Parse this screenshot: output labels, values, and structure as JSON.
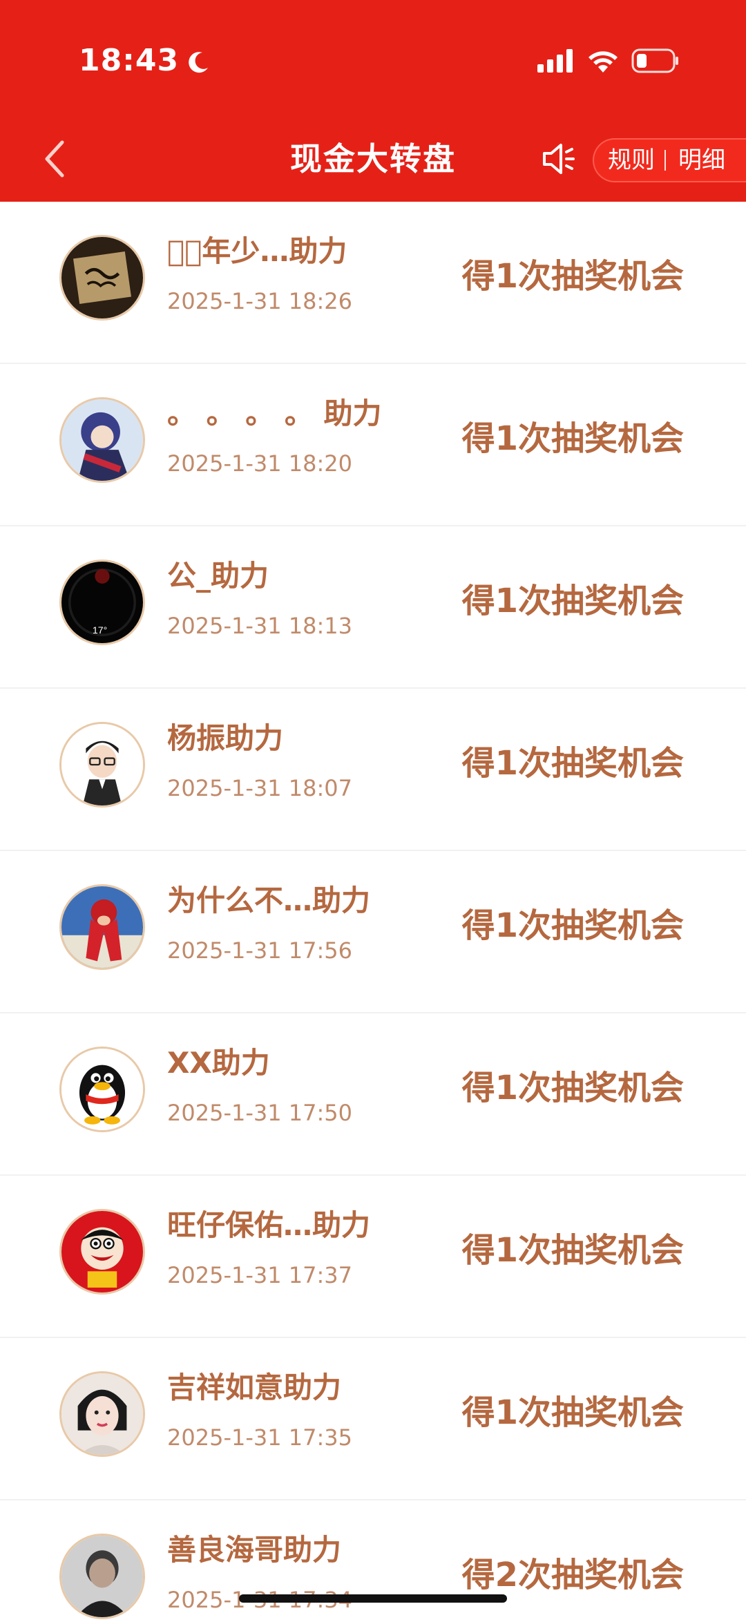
{
  "status_bar": {
    "time": "18:43",
    "moon_icon": "moon-icon",
    "signal_icon": "cellular-signal-icon",
    "wifi_icon": "wifi-icon",
    "battery_icon": "battery-low-icon"
  },
  "nav": {
    "back_icon": "chevron-left-icon",
    "title": "现金大转盘",
    "sound_icon": "speaker-icon",
    "rules_label": "规则",
    "details_label": "明细"
  },
  "colors": {
    "header_bg": "#e52117",
    "text_brown": "#b5683f",
    "time_brown": "#c08a6a"
  },
  "items": [
    {
      "name": "ঔ͙年少…助力",
      "time": "2025-1-31 18:26",
      "reward": "得1次抽奖机会",
      "avatar": "calligraphy-avatar"
    },
    {
      "name": "。 。 。 。 助力",
      "time": "2025-1-31 18:20",
      "reward": "得1次抽奖机会",
      "avatar": "anime-girl-avatar"
    },
    {
      "name": "公_助力",
      "time": "2025-1-31 18:13",
      "reward": "得1次抽奖机会",
      "avatar": "dark-watch-avatar"
    },
    {
      "name": "杨振助力",
      "time": "2025-1-31 18:07",
      "reward": "得1次抽奖机会",
      "avatar": "cartoon-man-glasses-avatar"
    },
    {
      "name": "为什么不…助力",
      "time": "2025-1-31 17:56",
      "reward": "得1次抽奖机会",
      "avatar": "red-scarf-avatar"
    },
    {
      "name": "XX助力",
      "time": "2025-1-31 17:50",
      "reward": "得1次抽奖机会",
      "avatar": "penguin-avatar"
    },
    {
      "name": "旺仔保佑…助力",
      "time": "2025-1-31 17:37",
      "reward": "得1次抽奖机会",
      "avatar": "wangzai-avatar"
    },
    {
      "name": "吉祥如意助力",
      "time": "2025-1-31 17:35",
      "reward": "得1次抽奖机会",
      "avatar": "woman-photo-avatar"
    },
    {
      "name": "善良海哥助力",
      "time": "2025-1-31 17:34",
      "reward": "得2次抽奖机会",
      "avatar": "man-photo-avatar"
    }
  ]
}
